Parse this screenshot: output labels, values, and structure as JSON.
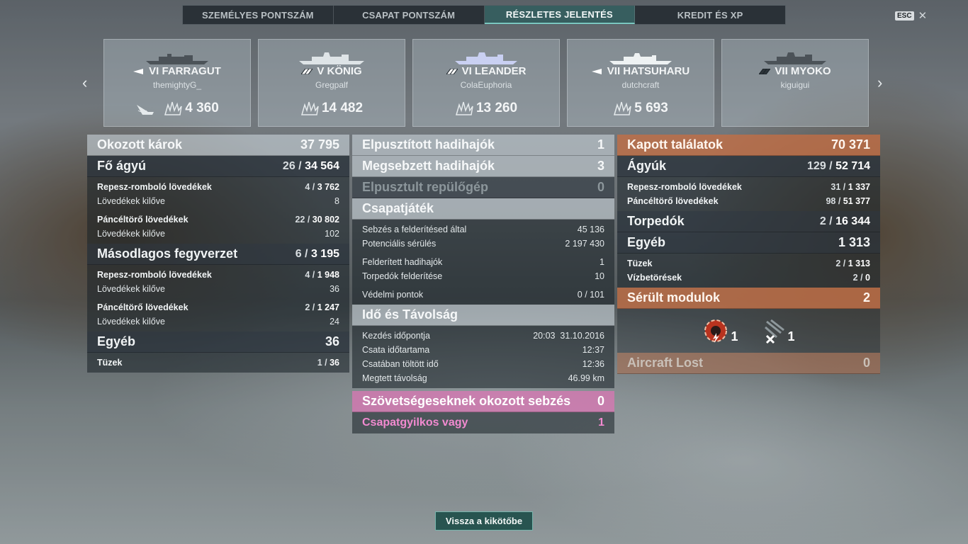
{
  "tabs": [
    "SZEMÉLYES PONTSZÁM",
    "CSAPAT PONTSZÁM",
    "RÉSZLETES JELENTÉS",
    "KREDIT ÉS XP"
  ],
  "active_tab": "RÉSZLETES JELENTÉS",
  "esc": {
    "key": "ESC",
    "close": "✕"
  },
  "nav": {
    "prev": "‹",
    "next": "›"
  },
  "ships": [
    {
      "name": "VI FARRAGUT",
      "player": "themightyG_",
      "score": "4 360",
      "class_icon": "destroyer-icon"
    },
    {
      "name": "V KÖNIG",
      "player": "Gregpalf",
      "score": "14 482",
      "class_icon": "battleship-icon"
    },
    {
      "name": "VI LEANDER",
      "player": "ColaEuphoria",
      "score": "13 260",
      "class_icon": "battleship-icon"
    },
    {
      "name": "VII HATSUHARU",
      "player": "dutchcraft",
      "score": "5 693",
      "class_icon": "destroyer-icon"
    },
    {
      "name": "VII MYOKO",
      "player": "kiguigui",
      "score": "",
      "class_icon": "cruiser-icon"
    }
  ],
  "left": {
    "damage": {
      "label": "Okozott károk",
      "value": "37 795"
    },
    "main_battery": {
      "label": "Fő ágyú",
      "hits": "26",
      "total": "34 564"
    },
    "he1": {
      "label": "Repesz-romboló lövedékek",
      "hits": "4",
      "total": "3 762"
    },
    "he1_shots": {
      "label": "Lövedékek kilőve",
      "value": "8"
    },
    "ap1": {
      "label": "Páncéltörő lövedékek",
      "hits": "22",
      "total": "30 802"
    },
    "ap1_shots": {
      "label": "Lövedékek kilőve",
      "value": "102"
    },
    "secondary": {
      "label": "Másodlagos fegyverzet",
      "hits": "6",
      "total": "3 195"
    },
    "he2": {
      "label": "Repesz-romboló lövedékek",
      "hits": "4",
      "total": "1 948"
    },
    "he2_shots": {
      "label": "Lövedékek kilőve",
      "value": "36"
    },
    "ap2": {
      "label": "Páncéltörő lövedékek",
      "hits": "2",
      "total": "1 247"
    },
    "ap2_shots": {
      "label": "Lövedékek kilőve",
      "value": "24"
    },
    "other": {
      "label": "Egyéb",
      "value": "36"
    },
    "fires": {
      "label": "Tüzek",
      "hits": "1",
      "total": "36"
    }
  },
  "middle": {
    "destroyed": {
      "label": "Elpusztított hadihajók",
      "value": "1"
    },
    "damaged": {
      "label": "Megsebzett hadihajók",
      "value": "3"
    },
    "planes": {
      "label": "Elpusztult repülőgép",
      "value": "0"
    },
    "teamplay": {
      "label": "Csapatjáték"
    },
    "spot_dmg": {
      "label": "Sebzés a felderítésed által",
      "value": "45 136"
    },
    "potential": {
      "label": "Potenciális sérülés",
      "value": "2 197 430"
    },
    "spotted": {
      "label": "Felderített hadihajók",
      "value": "1"
    },
    "torp_spot": {
      "label": "Torpedók felderítése",
      "value": "10"
    },
    "defense": {
      "label": "Védelmi pontok",
      "value": "0 / 101"
    },
    "time": {
      "label": "Idő és Távolság"
    },
    "start": {
      "label": "Kezdés időpontja",
      "value": "20:03  31.10.2016"
    },
    "duration": {
      "label": "Csata időtartama",
      "value": "12:37"
    },
    "in_battle": {
      "label": "Csatában töltött idő",
      "value": "12:36"
    },
    "distance": {
      "label": "Megtett távolság",
      "value": "46.99 km"
    },
    "ally_dmg": {
      "label": "Szövetségeseknek okozott sebzés",
      "value": "0"
    },
    "tk": {
      "label": "Csapatgyilkos vagy",
      "value": "1"
    }
  },
  "right": {
    "received": {
      "label": "Kapott találatok",
      "value": "70 371"
    },
    "guns": {
      "label": "Ágyúk",
      "hits": "129",
      "total": "52 714"
    },
    "he": {
      "label": "Repesz-romboló lövedékek",
      "hits": "31",
      "total": "1 337"
    },
    "ap": {
      "label": "Páncéltörő lövedékek",
      "hits": "98",
      "total": "51 377"
    },
    "torps": {
      "label": "Torpedók",
      "hits": "2",
      "total": "16 344"
    },
    "other": {
      "label": "Egyéb",
      "value": "1 313"
    },
    "fires": {
      "label": "Tüzek",
      "hits": "2",
      "total": "1 313"
    },
    "floods": {
      "label": "Vízbetörések",
      "hits": "2",
      "total": "0"
    },
    "modules": {
      "label": "Sérült modulok",
      "value": "2"
    },
    "mod1": "1",
    "mod2": "1",
    "aircraft": {
      "label": "Aircraft Lost",
      "value": "0"
    }
  },
  "back_button": "Vissza a kikötőbe",
  "colors": {
    "accent": "#7bc7c0",
    "orange": "#c46e44",
    "pink": "#de76b6"
  }
}
